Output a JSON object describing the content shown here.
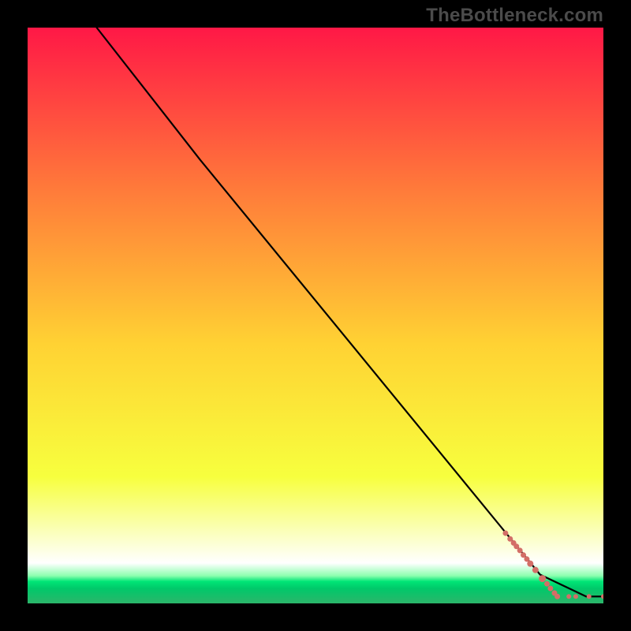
{
  "watermark": "TheBottleneck.com",
  "colors": {
    "frame": "#000000",
    "line": "#000000",
    "marker": "#d36e67",
    "grad_top": "#ff1846",
    "grad_mid_upper": "#ff7a3a",
    "grad_mid": "#ffd233",
    "grad_mid_lower": "#f7ff3e",
    "grad_pale": "#fbffc0",
    "grad_white": "#ffffff",
    "grad_mint1": "#8cffaf",
    "grad_mint2": "#00e576",
    "grad_mint3": "#00c96a",
    "grad_mint4": "#2cb56a"
  },
  "chart_data": {
    "type": "line",
    "xlim": [
      0,
      100
    ],
    "ylim": [
      0,
      100
    ],
    "title": "",
    "xlabel": "",
    "ylabel": "",
    "series": [
      {
        "name": "curve",
        "x": [
          12,
          30,
          89,
          97,
          100
        ],
        "y": [
          100,
          77,
          5,
          1.2,
          1.2
        ]
      }
    ],
    "markers": {
      "name": "row-points",
      "x": [
        83.0,
        83.8,
        84.4,
        84.9,
        85.5,
        86.1,
        86.7,
        87.3,
        88.2,
        89.4,
        90.2,
        90.8,
        91.5,
        92.0,
        94.0,
        95.2,
        97.5,
        100.0
      ],
      "y": [
        12.2,
        11.2,
        10.5,
        9.9,
        9.2,
        8.4,
        7.7,
        6.9,
        5.8,
        4.3,
        3.4,
        2.6,
        1.8,
        1.2,
        1.2,
        1.2,
        1.2,
        1.2
      ],
      "r": [
        3.5,
        3.5,
        3.5,
        3.5,
        3.5,
        3.5,
        3.5,
        4.0,
        4.0,
        4.5,
        3.5,
        3.5,
        3.5,
        3.5,
        3.0,
        3.0,
        3.0,
        3.0
      ]
    }
  }
}
